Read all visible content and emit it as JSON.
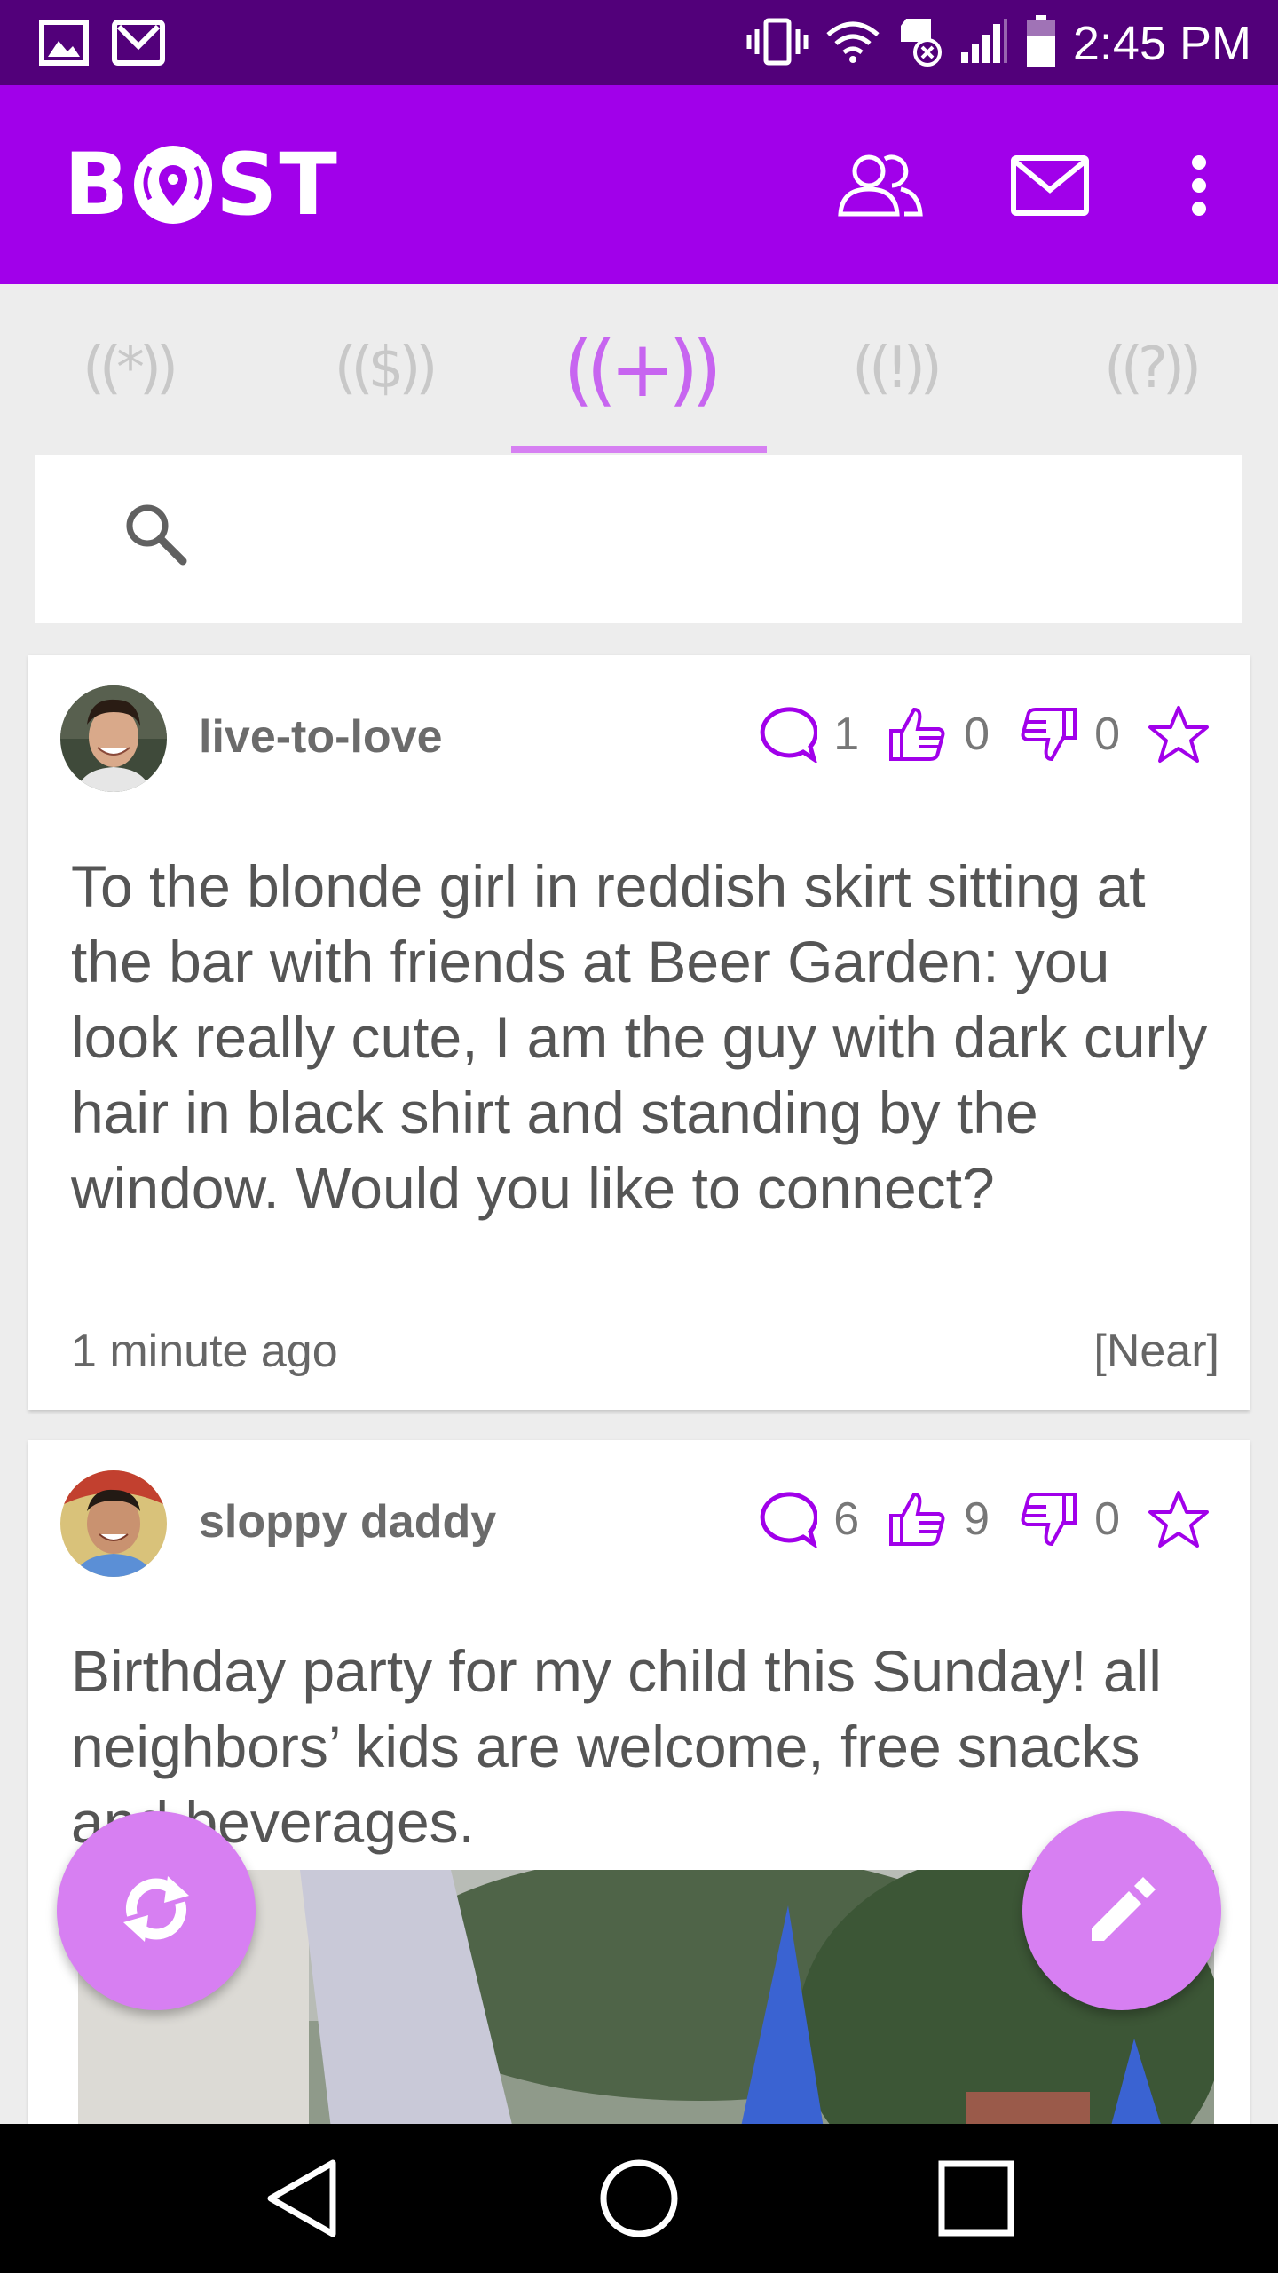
{
  "status_bar": {
    "time": "2:45 PM",
    "left_icons": [
      "gallery-icon",
      "gmail-icon"
    ],
    "right_icons": [
      "vibrate-icon",
      "wifi-icon",
      "sd-card-icon",
      "signal-icon",
      "battery-icon"
    ],
    "background": "#52007a"
  },
  "app_bar": {
    "logo": "BOOST",
    "actions": [
      "friends-icon",
      "mail-icon",
      "more-vert-icon"
    ],
    "background": "#a100ea"
  },
  "tabs": {
    "items": [
      {
        "label": "((*))"
      },
      {
        "label": "(($))"
      },
      {
        "label": "((+))"
      },
      {
        "label": "((!))"
      },
      {
        "label": "((?))"
      }
    ],
    "active_index": 2,
    "accent": "#c765f0"
  },
  "search": {
    "placeholder": ""
  },
  "posts": [
    {
      "username": "live-to-love",
      "comments": "1",
      "likes": "0",
      "dislikes": "0",
      "text": "To the blonde girl in reddish skirt sitting at the bar with friends at Beer Garden: you look really cute, I am the guy with dark curly hair in black shirt and standing by the window. Would you like to connect?",
      "time": "1 minute ago",
      "tag": "[Near]"
    },
    {
      "username": "sloppy daddy",
      "comments": "6",
      "likes": "9",
      "dislikes": "0",
      "text": "Birthday party for my child this Sunday! all neighbors’ kids are welcome, free snacks and beverages."
    }
  ],
  "fabs": [
    "refresh-icon",
    "edit-icon"
  ],
  "nav_bar": [
    "back-icon",
    "home-icon",
    "recents-icon"
  ]
}
